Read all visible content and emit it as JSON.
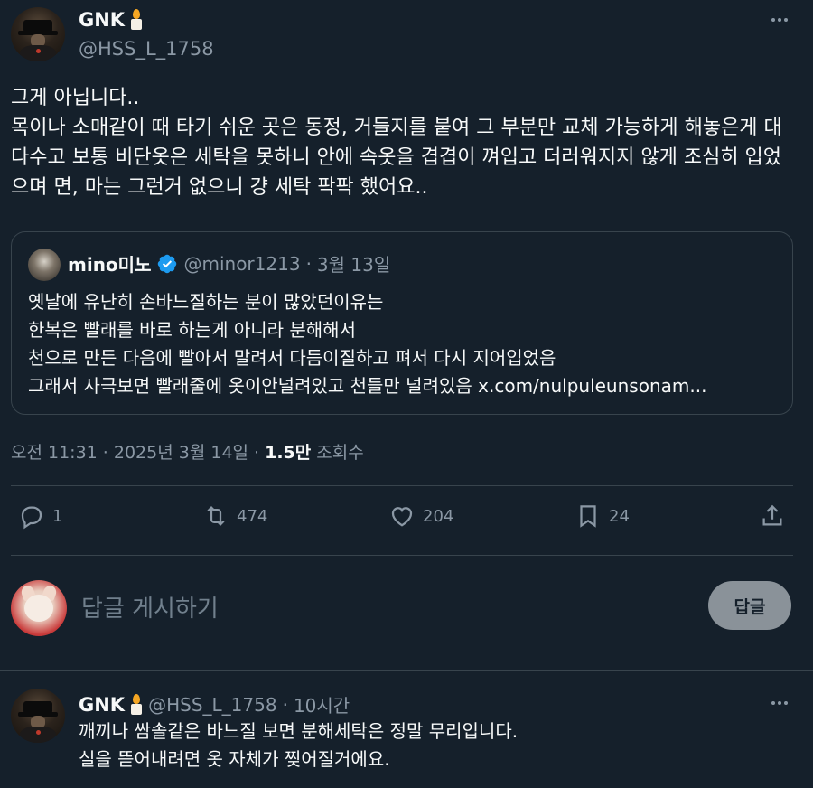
{
  "main_tweet": {
    "author": {
      "display_name": "GNK",
      "handle": "@HSS_L_1758"
    },
    "body": "그게 아닙니다..\n목이나 소매같이 때 타기 쉬운 곳은 동정, 거들지를 붙여 그 부분만 교체 가능하게 해놓은게 대다수고 보통 비단옷은 세탁을 못하니 안에 속옷을 겹겹이 껴입고 더러워지지 않게 조심히 입었으며 면, 마는 그런거 없으니 걍 세탁 팍팍 했어요..",
    "quote": {
      "display_name": "mino미노",
      "handle": "@minor1213",
      "separator": "·",
      "date": "3월 13일",
      "body": "옛날에 유난히 손바느질하는 분이 많았던이유는\n한복은 빨래를 바로 하는게 아니라 분해해서\n천으로 만든 다음에 빨아서 말려서 다듬이질하고 펴서 다시 지어입었음\n그래서 사극보면 빨래줄에 옷이안널려있고 천들만 널려있음 x.com/nulpuleunsonam..."
    },
    "timestamp": "오전 11:31 · 2025년 3월 14일 ·",
    "views_count": "1.5만",
    "views_label": "조회수",
    "actions": {
      "replies": "1",
      "retweets": "474",
      "likes": "204",
      "bookmarks": "24"
    }
  },
  "composer": {
    "placeholder": "답글 게시하기",
    "button_label": "답글"
  },
  "reply_tweet": {
    "display_name": "GNK",
    "handle": "@HSS_L_1758",
    "separator": "·",
    "time_ago": "10시간",
    "body": "깨끼나 쌈솔같은 바느질 보면 분해세탁은 정말 무리입니다.\n실을 뜯어내려면 옷 자체가 찢어질거에요."
  },
  "colors": {
    "background": "#15202b",
    "text": "#f7f9f9",
    "muted": "#8b98a5",
    "border": "#38444d",
    "verified_blue": "#1d9bf0"
  }
}
